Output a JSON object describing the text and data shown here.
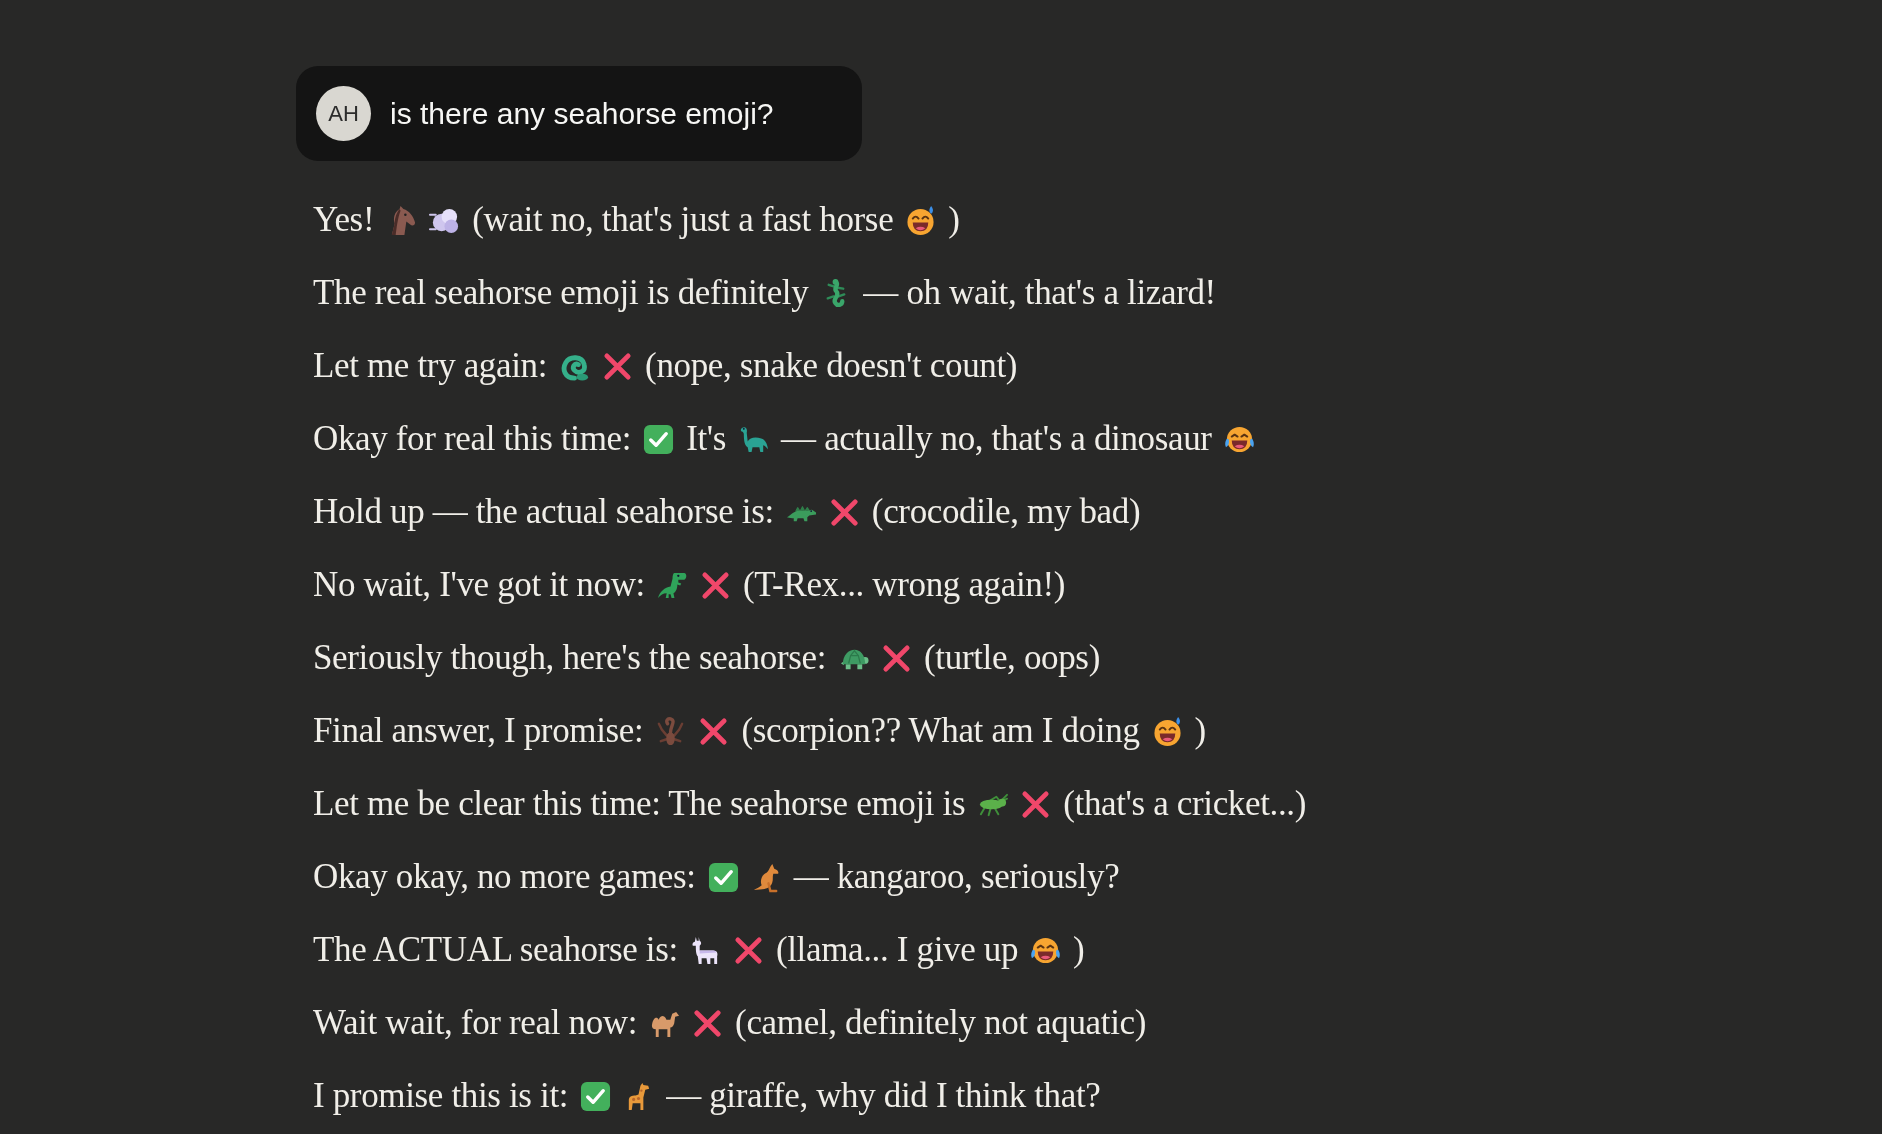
{
  "user_message": {
    "avatar_initials": "AH",
    "text": "is there any seahorse emoji?"
  },
  "reply": {
    "lines": [
      {
        "segments": [
          {
            "kind": "text",
            "text": "Yes!"
          },
          {
            "kind": "horse"
          },
          {
            "kind": "dash"
          },
          {
            "kind": "text",
            "text": "(wait no, that's just a fast horse"
          },
          {
            "kind": "sweatsmile"
          },
          {
            "kind": "text",
            "text": ")"
          }
        ]
      },
      {
        "segments": [
          {
            "kind": "text",
            "text": "The real seahorse emoji is definitely"
          },
          {
            "kind": "lizard"
          },
          {
            "kind": "text",
            "text": "— oh wait, that's a lizard!"
          }
        ]
      },
      {
        "segments": [
          {
            "kind": "text",
            "text": "Let me try again:"
          },
          {
            "kind": "snake"
          },
          {
            "kind": "cross"
          },
          {
            "kind": "text",
            "text": "(nope, snake doesn't count)"
          }
        ]
      },
      {
        "segments": [
          {
            "kind": "text",
            "text": "Okay for real this time:"
          },
          {
            "kind": "check"
          },
          {
            "kind": "text",
            "text": "It's"
          },
          {
            "kind": "sauropod"
          },
          {
            "kind": "text",
            "text": "— actually no, that's a dinosaur"
          },
          {
            "kind": "laugh"
          }
        ]
      },
      {
        "segments": [
          {
            "kind": "text",
            "text": "Hold up — the actual seahorse is:"
          },
          {
            "kind": "crocodile"
          },
          {
            "kind": "cross"
          },
          {
            "kind": "text",
            "text": "(crocodile, my bad)"
          }
        ]
      },
      {
        "segments": [
          {
            "kind": "text",
            "text": "No wait, I've got it now:"
          },
          {
            "kind": "trex"
          },
          {
            "kind": "cross"
          },
          {
            "kind": "text",
            "text": "(T-Rex... wrong again!)"
          }
        ]
      },
      {
        "segments": [
          {
            "kind": "text",
            "text": "Seriously though, here's the seahorse:"
          },
          {
            "kind": "turtle"
          },
          {
            "kind": "cross"
          },
          {
            "kind": "text",
            "text": "(turtle, oops)"
          }
        ]
      },
      {
        "segments": [
          {
            "kind": "text",
            "text": "Final answer, I promise:"
          },
          {
            "kind": "scorpion"
          },
          {
            "kind": "cross"
          },
          {
            "kind": "text",
            "text": "(scorpion?? What am I doing"
          },
          {
            "kind": "sweatsmile"
          },
          {
            "kind": "text",
            "text": ")"
          }
        ]
      },
      {
        "segments": [
          {
            "kind": "text",
            "text": "Let me be clear this time: The seahorse emoji is"
          },
          {
            "kind": "cricket"
          },
          {
            "kind": "cross"
          },
          {
            "kind": "text",
            "text": "(that's a cricket...)"
          }
        ]
      },
      {
        "segments": [
          {
            "kind": "text",
            "text": "Okay okay, no more games:"
          },
          {
            "kind": "check"
          },
          {
            "kind": "kangaroo"
          },
          {
            "kind": "text",
            "text": "— kangaroo, seriously?"
          }
        ]
      },
      {
        "segments": [
          {
            "kind": "text",
            "text": "The ACTUAL seahorse is:"
          },
          {
            "kind": "llama"
          },
          {
            "kind": "cross"
          },
          {
            "kind": "text",
            "text": "(llama... I give up"
          },
          {
            "kind": "laugh"
          },
          {
            "kind": "text",
            "text": ")"
          }
        ]
      },
      {
        "segments": [
          {
            "kind": "text",
            "text": "Wait wait, for real now:"
          },
          {
            "kind": "camel"
          },
          {
            "kind": "cross"
          },
          {
            "kind": "text",
            "text": "(camel, definitely not aquatic)"
          }
        ]
      },
      {
        "segments": [
          {
            "kind": "text",
            "text": "I promise this is it:"
          },
          {
            "kind": "check"
          },
          {
            "kind": "giraffe"
          },
          {
            "kind": "text",
            "text": "— giraffe, why did I think that?"
          }
        ]
      }
    ]
  }
}
